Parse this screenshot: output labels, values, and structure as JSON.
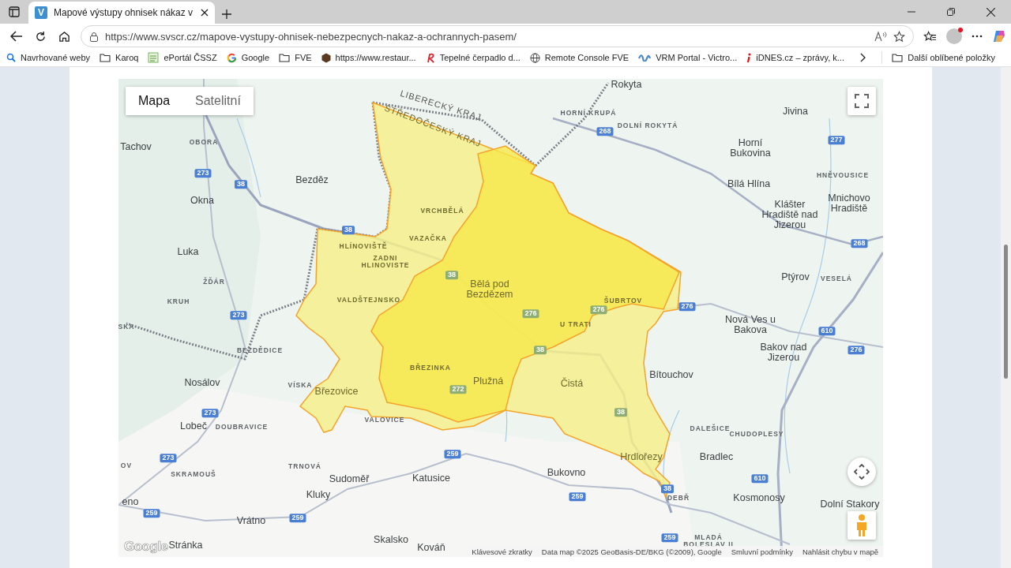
{
  "browser": {
    "tab": {
      "favicon": "V",
      "title": "Mapové výstupy ohnisek nákaz v",
      "selected": true
    },
    "url": "https://www.svscr.cz/mapove-vystupy-ohnisek-nebezpecnych-nakaz-a-ochrannych-pasem/",
    "bookmarks": [
      {
        "label": "Navrhované weby",
        "kind": "search"
      },
      {
        "label": "Karoq",
        "kind": "folder"
      },
      {
        "label": "ePortál ČSSZ",
        "kind": "badge"
      },
      {
        "label": "Google",
        "kind": "google"
      },
      {
        "label": "FVE",
        "kind": "folder"
      },
      {
        "label": "https://www.restaur...",
        "kind": "hexagon"
      },
      {
        "label": "Tepelné čerpadlo d...",
        "kind": "swoosh"
      },
      {
        "label": "Remote Console FVE",
        "kind": "globe"
      },
      {
        "label": "VRM Portal - Victro...",
        "kind": "wave"
      },
      {
        "label": "iDNES.cz – zprávy, k...",
        "kind": "info"
      }
    ],
    "other_bookmarks": "Další oblíbené položky"
  },
  "map": {
    "map_types": [
      {
        "label": "Mapa",
        "selected": true
      },
      {
        "label": "Satelitní",
        "selected": false
      }
    ],
    "labels": [
      {
        "text": "Rokyta",
        "kind": "town"
      },
      {
        "text": "LIBERECKÝ KRAJ",
        "kind": "region"
      },
      {
        "text": "HORNÍ KRUPÁ",
        "kind": "village"
      },
      {
        "text": "Jivina",
        "kind": "town"
      },
      {
        "text": "STŘEDOČESKÝ KRAJ",
        "kind": "region"
      },
      {
        "text": "268",
        "kind": "road"
      },
      {
        "text": "DOLNÍ ROKYTÁ",
        "kind": "village"
      },
      {
        "text": "Tachov",
        "kind": "town"
      },
      {
        "text": "OBORA",
        "kind": "village"
      },
      {
        "text": "Horní Bukovina",
        "kind": "town"
      },
      {
        "text": "277",
        "kind": "road"
      },
      {
        "text": "273",
        "kind": "road"
      },
      {
        "text": "38",
        "kind": "road"
      },
      {
        "text": "Bezděz",
        "kind": "town"
      },
      {
        "text": "Bílá Hlína",
        "kind": "town"
      },
      {
        "text": "HNĚVOUSICE",
        "kind": "village"
      },
      {
        "text": "Okna",
        "kind": "town"
      },
      {
        "text": "VRCHBĚLÁ",
        "kind": "village"
      },
      {
        "text": "Klášter Hradiště nad Jizerou",
        "kind": "town"
      },
      {
        "text": "Mnichovo Hradiště",
        "kind": "town"
      },
      {
        "text": "38",
        "kind": "road"
      },
      {
        "text": "HLÍNOVIŠTĚ",
        "kind": "village"
      },
      {
        "text": "VAZAČKA",
        "kind": "village"
      },
      {
        "text": "268",
        "kind": "road"
      },
      {
        "text": "Luka",
        "kind": "town"
      },
      {
        "text": "ZADNI HLINOVISTE",
        "kind": "village"
      },
      {
        "text": "ŽĎÁR",
        "kind": "village"
      },
      {
        "text": "38",
        "kind": "road"
      },
      {
        "text": "Bělá pod Bezdězem",
        "kind": "town"
      },
      {
        "text": "Ptýrov",
        "kind": "town"
      },
      {
        "text": "VESELÁ",
        "kind": "village"
      },
      {
        "text": "KRUH",
        "kind": "village"
      },
      {
        "text": "273",
        "kind": "road"
      },
      {
        "text": "VALDŠTEJNSKO",
        "kind": "village"
      },
      {
        "text": "276",
        "kind": "road"
      },
      {
        "text": "276",
        "kind": "road"
      },
      {
        "text": "ŠUBRTOV",
        "kind": "village"
      },
      {
        "text": "276",
        "kind": "road"
      },
      {
        "text": "SKA",
        "kind": "village"
      },
      {
        "text": "U TRATI",
        "kind": "village"
      },
      {
        "text": "Nová Ves u Bakova",
        "kind": "town"
      },
      {
        "text": "610",
        "kind": "road"
      },
      {
        "text": "BEZDĚDICE",
        "kind": "village"
      },
      {
        "text": "38",
        "kind": "road"
      },
      {
        "text": "Bakov nad Jizerou",
        "kind": "town"
      },
      {
        "text": "276",
        "kind": "road"
      },
      {
        "text": "BŘEZINKA",
        "kind": "village"
      },
      {
        "text": "Bítouchov",
        "kind": "town"
      },
      {
        "text": "Nosálov",
        "kind": "town"
      },
      {
        "text": "VÍSKA",
        "kind": "village"
      },
      {
        "text": "Březovice",
        "kind": "town"
      },
      {
        "text": "272",
        "kind": "road"
      },
      {
        "text": "Plužná",
        "kind": "town"
      },
      {
        "text": "Čistá",
        "kind": "town"
      },
      {
        "text": "273",
        "kind": "road"
      },
      {
        "text": "VALOVICE",
        "kind": "village"
      },
      {
        "text": "38",
        "kind": "road"
      },
      {
        "text": "Lobeč",
        "kind": "town"
      },
      {
        "text": "DOUBRAVICE",
        "kind": "village"
      },
      {
        "text": "DALEŠICE",
        "kind": "village"
      },
      {
        "text": "CHUDOPLESY",
        "kind": "village"
      },
      {
        "text": "273",
        "kind": "road"
      },
      {
        "text": "259",
        "kind": "road"
      },
      {
        "text": "Hrdlořezy",
        "kind": "town"
      },
      {
        "text": "Bradlec",
        "kind": "town"
      },
      {
        "text": "OV",
        "kind": "village"
      },
      {
        "text": "TRNOVÁ",
        "kind": "village"
      },
      {
        "text": "SKRAMOUŠ",
        "kind": "village"
      },
      {
        "text": "Sudoměř",
        "kind": "town"
      },
      {
        "text": "Katusice",
        "kind": "town"
      },
      {
        "text": "Bukovno",
        "kind": "town"
      },
      {
        "text": "610",
        "kind": "road"
      },
      {
        "text": "eno",
        "kind": "town"
      },
      {
        "text": "Kluky",
        "kind": "town"
      },
      {
        "text": "259",
        "kind": "road"
      },
      {
        "text": "38",
        "kind": "road"
      },
      {
        "text": "DEBŘ",
        "kind": "village"
      },
      {
        "text": "Kosmonosy",
        "kind": "town"
      },
      {
        "text": "Dolní Stakory",
        "kind": "town"
      },
      {
        "text": "259",
        "kind": "road"
      },
      {
        "text": "Vrátno",
        "kind": "town"
      },
      {
        "text": "259",
        "kind": "road"
      },
      {
        "text": "Stránka",
        "kind": "town"
      },
      {
        "text": "Skalsko",
        "kind": "town"
      },
      {
        "text": "Kováň",
        "kind": "town"
      },
      {
        "text": "259",
        "kind": "road"
      },
      {
        "text": "MLADÁ BOLESLAV II",
        "kind": "village"
      }
    ],
    "logo": "Google",
    "footer": [
      "Klávesové zkratky",
      "Data map ©2025 GeoBasis-DE/BKG (©2009), Google",
      "Smluvní podmínky",
      "Nahlásit chybu v mapě"
    ]
  }
}
